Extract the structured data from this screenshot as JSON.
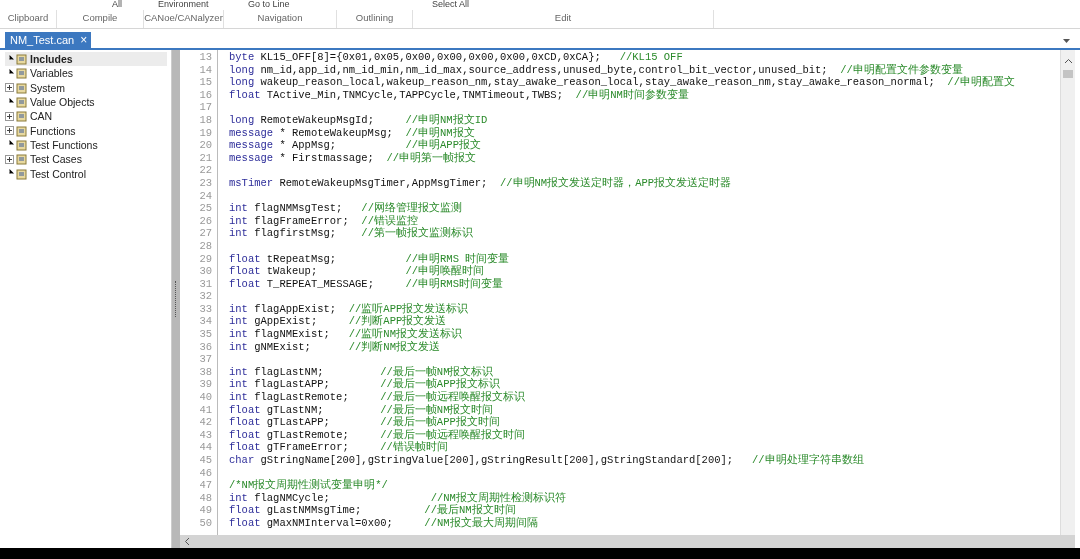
{
  "ribbon": {
    "buttons": [
      {
        "label": "All"
      },
      {
        "label": "Environment"
      },
      {
        "label": "Go to Line"
      },
      {
        "label": "Select All"
      }
    ],
    "groups": [
      "Clipboard",
      "Compile",
      "CANoe/CANalyzer",
      "Navigation",
      "Outlining",
      "Edit"
    ]
  },
  "tabs": [
    {
      "label": "NM_Test.can",
      "selected": true,
      "close": "×"
    }
  ],
  "tree": [
    {
      "label": "Includes",
      "selected": true,
      "expandable": false
    },
    {
      "label": "Variables",
      "selected": false,
      "expandable": false
    },
    {
      "label": "System",
      "selected": false,
      "expandable": true
    },
    {
      "label": "Value Objects",
      "selected": false,
      "expandable": false
    },
    {
      "label": "CAN",
      "selected": false,
      "expandable": true
    },
    {
      "label": "Functions",
      "selected": false,
      "expandable": true
    },
    {
      "label": "Test Functions",
      "selected": false,
      "expandable": false
    },
    {
      "label": "Test Cases",
      "selected": false,
      "expandable": true
    },
    {
      "label": "Test Control",
      "selected": false,
      "expandable": false
    }
  ],
  "code_lines": [
    {
      "number": "13",
      "keyword": "byte",
      "code": " KL15_OFF[8]={0x01,0x05,0x00,0x00,0x00,0x00,0xCD,0xCA};   ",
      "comment": "//KL15 OFF"
    },
    {
      "number": "14",
      "keyword": "long",
      "code": " nm_id,app_id,nm_id_min,nm_id_max,source_address,unused_byte,control_bit_vector,unused_bit;  ",
      "comment": "//申明配置文件参数变量"
    },
    {
      "number": "15",
      "keyword": "long",
      "code": " wakeup_reason_local,wakeup_reason_nm,stay_awake_reason_local,stay_awake_reason_nm,stay_awake_reason_normal;  ",
      "comment": "//申明配置文"
    },
    {
      "number": "16",
      "keyword": "float",
      "code": " TActive_Min,TNMCycle,TAPPCycle,TNMTimeout,TWBS;  ",
      "comment": "//申明NM时间参数变量"
    },
    {
      "number": "17"
    },
    {
      "number": "18",
      "keyword": "long",
      "code": " RemoteWakeupMsgId;     ",
      "comment": "//申明NM报文ID"
    },
    {
      "number": "19",
      "keyword": "message",
      "code": " * RemoteWakeupMsg;  ",
      "comment": "//申明NM报文"
    },
    {
      "number": "20",
      "keyword": "message",
      "code": " * AppMsg;           ",
      "comment": "//申明APP报文"
    },
    {
      "number": "21",
      "keyword": "message",
      "code": " * Firstmassage;  ",
      "comment": "//申明第一帧报文"
    },
    {
      "number": "22"
    },
    {
      "number": "23",
      "keyword": "msTimer",
      "code": " RemoteWakeupMsgTimer,AppMsgTimer;  ",
      "comment": "//申明NM报文发送定时器，APP报文发送定时器"
    },
    {
      "number": "24"
    },
    {
      "number": "25",
      "keyword": "int",
      "code": " flagNMMsgTest;   ",
      "comment": "//网络管理报文监测"
    },
    {
      "number": "26",
      "keyword": "int",
      "code": " flagFrameError;  ",
      "comment": "//错误监控"
    },
    {
      "number": "27",
      "keyword": "int",
      "code": " flagfirstMsg;    ",
      "comment": "//第一帧报文监测标识"
    },
    {
      "number": "28"
    },
    {
      "number": "29",
      "keyword": "float",
      "code": " tRepeatMsg;           ",
      "comment": "//申明RMS 时间变量"
    },
    {
      "number": "30",
      "keyword": "float",
      "code": " tWakeup;              ",
      "comment": "//申明唤醒时间"
    },
    {
      "number": "31",
      "keyword": "float",
      "code": " T_REPEAT_MESSAGE;     ",
      "comment": "//申明RMS时间变量"
    },
    {
      "number": "32"
    },
    {
      "number": "33",
      "keyword": "int",
      "code": " flagAppExist;  ",
      "comment": "//监听APP报文发送标识"
    },
    {
      "number": "34",
      "keyword": "int",
      "code": " gAppExist;     ",
      "comment": "//判断APP报文发送"
    },
    {
      "number": "35",
      "keyword": "int",
      "code": " flagNMExist;   ",
      "comment": "//监听NM报文发送标识"
    },
    {
      "number": "36",
      "keyword": "int",
      "code": " gNMExist;      ",
      "comment": "//判断NM报文发送"
    },
    {
      "number": "37"
    },
    {
      "number": "38",
      "keyword": "int",
      "code": " flagLastNM;         ",
      "comment": "//最后一帧NM报文标识"
    },
    {
      "number": "39",
      "keyword": "int",
      "code": " flagLastAPP;        ",
      "comment": "//最后一帧APP报文标识"
    },
    {
      "number": "40",
      "keyword": "int",
      "code": " flagLastRemote;     ",
      "comment": "//最后一帧远程唤醒报文标识"
    },
    {
      "number": "41",
      "keyword": "float",
      "code": " gTLastNM;         ",
      "comment": "//最后一帧NM报文时间"
    },
    {
      "number": "42",
      "keyword": "float",
      "code": " gTLastAPP;        ",
      "comment": "//最后一帧APP报文时间"
    },
    {
      "number": "43",
      "keyword": "float",
      "code": " gTLastRemote;     ",
      "comment": "//最后一帧远程唤醒报文时间"
    },
    {
      "number": "44",
      "keyword": "float",
      "code": " gTFrameError;     ",
      "comment": "//错误帧时间"
    },
    {
      "number": "45",
      "keyword": "char",
      "code": " gStringName[200],gStringValue[200],gStringResult[200],gStringStandard[200];   ",
      "comment": "//申明处理字符串数组"
    },
    {
      "number": "46"
    },
    {
      "number": "47",
      "comment": "/*NM报文周期性测试变量申明*/"
    },
    {
      "number": "48",
      "keyword": "int",
      "code": " flagNMCycle;                ",
      "comment": "//NM报文周期性检测标识符"
    },
    {
      "number": "49",
      "keyword": "float",
      "code": " gLastNMMsgTime;          ",
      "comment": "//最后NM报文时间"
    },
    {
      "number": "50",
      "keyword": "float",
      "code": " gMaxNMInterval=0x00;     ",
      "comment": "//NM报文最大周期间隔"
    }
  ]
}
